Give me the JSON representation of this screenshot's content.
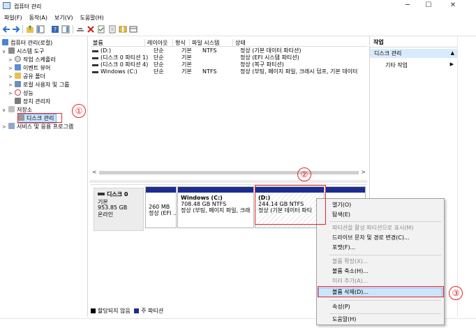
{
  "window": {
    "title": "컴퓨터 관리",
    "minimize_glyph": "─",
    "maximize_glyph": "☐",
    "close_glyph": "✕"
  },
  "menu": [
    "파일(F)",
    "동작(A)",
    "보기(V)",
    "도움말(H)"
  ],
  "toolbar_icons": [
    "back-arrow-icon",
    "forward-arrow-icon",
    "up-folder-icon",
    "show-hide-tree-icon",
    "help-icon",
    "show-hide-action-icon",
    "connect-icon",
    "delete-icon",
    "checklist-icon",
    "properties-icon",
    "help-book-icon",
    "disk-view-icon"
  ],
  "tree": {
    "root": "컴퓨터 관리(로컬)",
    "system_tools": "시스템 도구",
    "task_scheduler": "작업 스케줄러",
    "event_viewer": "이벤트 뷰어",
    "shared_folders": "공유 폴더",
    "local_users": "로컬 사용자 및 그룹",
    "performance": "성능",
    "device_manager": "장치 관리자",
    "storage": "저장소",
    "disk_management": "디스크 관리",
    "services": "서비스 및 응용 프로그램"
  },
  "volume_table": {
    "headers": [
      "볼륨",
      "레이아웃",
      "형식",
      "파일 시스템",
      "상태"
    ],
    "rows": [
      {
        "volume": "(D:)",
        "layout": "단순",
        "type": "기본",
        "fs": "NTFS",
        "status": "정상 (기본 데이터 파티션)"
      },
      {
        "volume": "(디스크 0 파티션 1)",
        "layout": "단순",
        "type": "기본",
        "fs": "",
        "status": "정상 (EFI 시스템 파티션)"
      },
      {
        "volume": "(디스크 0 파티션 4)",
        "layout": "단순",
        "type": "기본",
        "fs": "",
        "status": "정상 (복구 파티션)"
      },
      {
        "volume": "Windows (C:)",
        "layout": "단순",
        "type": "기본",
        "fs": "NTFS",
        "status": "정상 (부팅, 페이지 파일, 크래시 덤프, 기본 데이터"
      }
    ],
    "scroll_left": "<",
    "scroll_right": ">"
  },
  "disk": {
    "name": "디스크 0",
    "type": "기본",
    "size": "953.85 GB",
    "state": "온라인",
    "partitions": [
      {
        "label": "",
        "size": "260 MB",
        "status": "정상 (EFI ..."
      },
      {
        "label": "Windows  (C:)",
        "size": "708.48 GB NTFS",
        "status": "정상 (부팅, 페이지 파일, 크래"
      },
      {
        "label": "(D:)",
        "size": "244.14 GB NTFS",
        "status": "정상 (기본 데이터 파티"
      }
    ]
  },
  "legend": {
    "unallocated": "할당되지 않음",
    "primary": "주 파티션"
  },
  "actions": {
    "header": "작업",
    "section": "디스크 관리",
    "more": "기타 작업"
  },
  "context_menu": {
    "open": "열기(O)",
    "explore": "탐색(E)",
    "mark_active": "파티션을 활성 파티션으로 표시(M)",
    "change_letter": "드라이브 문자 및 경로 변경(C)...",
    "format": "포맷(F)...",
    "extend": "볼륨 확장(X)...",
    "shrink": "볼륨 축소(H)...",
    "mirror": "미러 추가(A)...",
    "delete": "볼륨 삭제(D)...",
    "properties": "속성(P)",
    "help": "도움말(H)"
  },
  "annotations": {
    "one": "①",
    "two": "②",
    "three": "③"
  },
  "colors": {
    "primary_partition": "#1c2d8f",
    "unallocated": "#000000",
    "selection": "#cce3fb",
    "annotation": "#e52528"
  }
}
